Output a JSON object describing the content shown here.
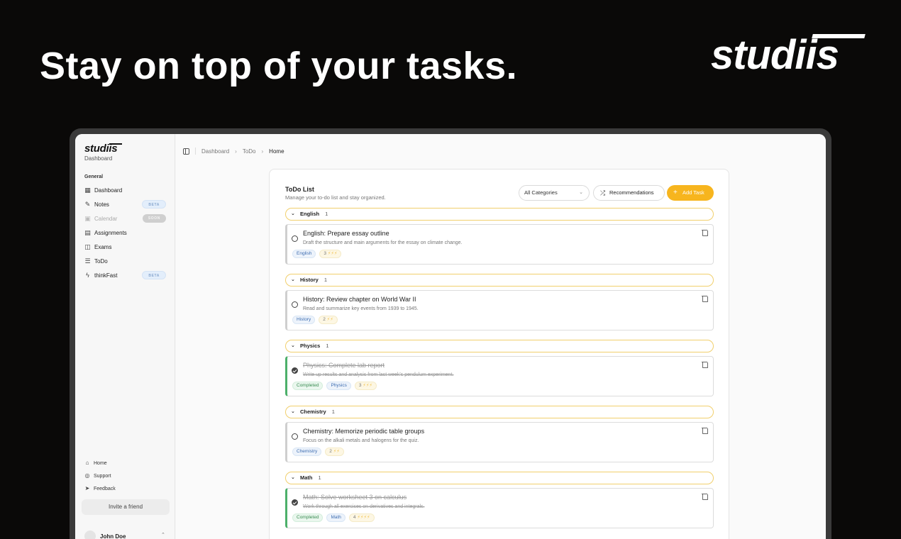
{
  "hero": {
    "title": "Stay on top of your tasks.",
    "logo": "studiis"
  },
  "sidebar": {
    "logo": "studiis",
    "subtitle": "Dashboard",
    "section": "General",
    "items": [
      {
        "label": "Dashboard",
        "icon": "grid-icon"
      },
      {
        "label": "Notes",
        "icon": "note-edit-icon",
        "badge": "BETA"
      },
      {
        "label": "Calendar",
        "icon": "calendar-icon",
        "badge": "SOON"
      },
      {
        "label": "Assignments",
        "icon": "document-icon"
      },
      {
        "label": "Exams",
        "icon": "book-icon"
      },
      {
        "label": "ToDo",
        "icon": "list-icon"
      },
      {
        "label": "thinkFast",
        "icon": "lightning-icon",
        "badge": "BETA"
      }
    ],
    "footer": [
      {
        "label": "Home",
        "icon": "home-icon"
      },
      {
        "label": "Support",
        "icon": "lifebuoy-icon"
      },
      {
        "label": "Feedback",
        "icon": "send-icon"
      }
    ],
    "invite": "Invite a friend",
    "user": "John Doe"
  },
  "breadcrumb": {
    "items": [
      "Dashboard",
      "ToDo",
      "Home"
    ]
  },
  "todo": {
    "title": "ToDo List",
    "subtitle": "Manage your to-do list and stay organized.",
    "filter": "All Categories",
    "recommend_label": "Recommendations",
    "add_label": "Add Task",
    "accent": "#f7b51e",
    "groups": [
      {
        "name": "English",
        "count": "1",
        "task": {
          "title": "English: Prepare essay outline",
          "desc": "Draft the structure and main arguments for the essay on climate change.",
          "completed": false,
          "category": "English",
          "priority": "3",
          "bolts": "⚡⚡⚡"
        }
      },
      {
        "name": "History",
        "count": "1",
        "task": {
          "title": "History: Review chapter on World War II",
          "desc": "Read and summarize key events from 1939 to 1945.",
          "completed": false,
          "category": "History",
          "priority": "2",
          "bolts": "⚡⚡"
        }
      },
      {
        "name": "Physics",
        "count": "1",
        "task": {
          "title": "Physics: Complete lab report",
          "desc": "Write up results and analysis from last week's pendulum experiment.",
          "completed": true,
          "status": "Completed",
          "category": "Physics",
          "priority": "3",
          "bolts": "⚡⚡⚡"
        }
      },
      {
        "name": "Chemistry",
        "count": "1",
        "task": {
          "title": "Chemistry: Memorize periodic table groups",
          "desc": "Focus on the alkali metals and halogens for the quiz.",
          "completed": false,
          "category": "Chemistry",
          "priority": "2",
          "bolts": "⚡⚡"
        }
      },
      {
        "name": "Math",
        "count": "1",
        "task": {
          "title": "Math: Solve worksheet 3 on calculus",
          "desc": "Work through all exercises on derivatives and integrals.",
          "completed": true,
          "status": "Completed",
          "category": "Math",
          "priority": "4",
          "bolts": "⚡⚡⚡⚡"
        }
      }
    ]
  }
}
